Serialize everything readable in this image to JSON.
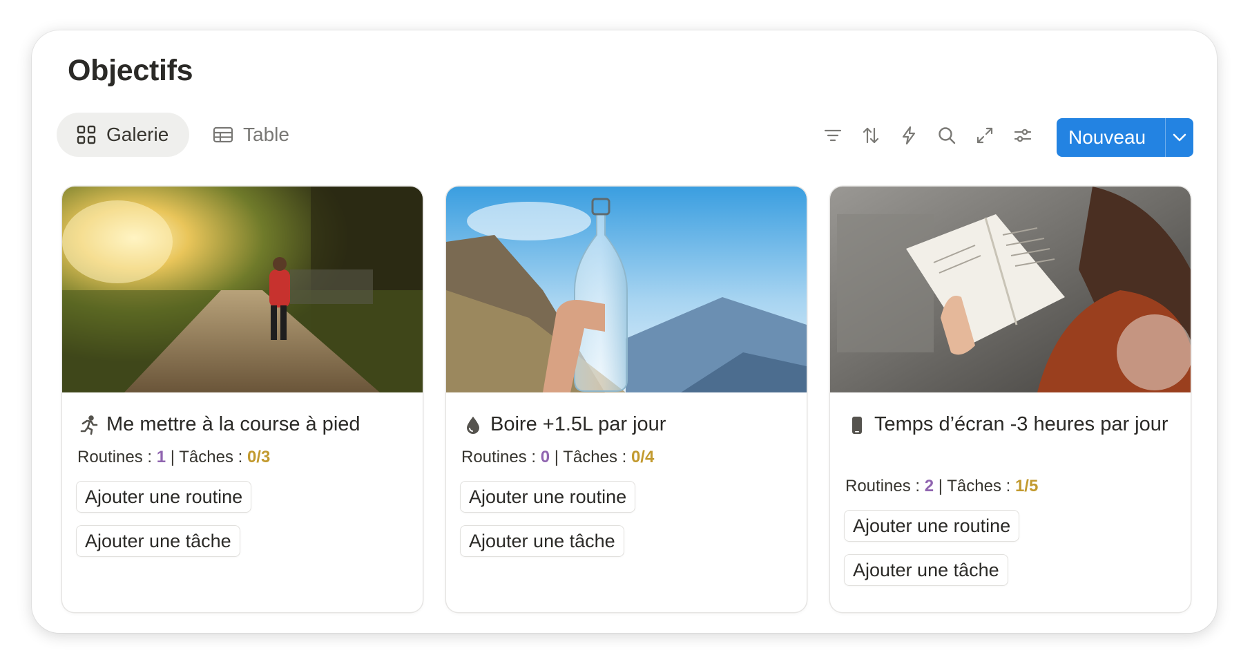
{
  "page": {
    "title": "Objectifs"
  },
  "views": {
    "galerie_label": "Galerie",
    "table_label": "Table"
  },
  "toolbar": {
    "icons": [
      "filter-icon",
      "sort-icon",
      "automation-icon",
      "search-icon",
      "expand-icon",
      "settings-icon"
    ],
    "new_label": "Nouveau"
  },
  "colors": {
    "accent": "#2383e2",
    "routines_count": "#9065b0",
    "tasks_count": "#c29a2f"
  },
  "cards": [
    {
      "icon": "running-person-icon",
      "title": "Me mettre à la course à pied",
      "routines_label": "Routines :",
      "routines_count": "1",
      "sep": "|",
      "tasks_label": "Tâches :",
      "tasks_count": "0/3",
      "add_routine_label": "Ajouter une routine",
      "add_task_label": "Ajouter une tâche"
    },
    {
      "icon": "water-drop-icon",
      "title": "Boire +1.5L par jour",
      "routines_label": "Routines :",
      "routines_count": "0",
      "sep": "|",
      "tasks_label": "Tâches :",
      "tasks_count": "0/4",
      "add_routine_label": "Ajouter une routine",
      "add_task_label": "Ajouter une tâche"
    },
    {
      "icon": "smartphone-icon",
      "title": "Temps d’écran -3 heures par jour",
      "routines_label": "Routines :",
      "routines_count": "2",
      "sep": "|",
      "tasks_label": "Tâches :",
      "tasks_count": "1/5",
      "add_routine_label": "Ajouter une routine",
      "add_task_label": "Ajouter une tâche"
    }
  ]
}
